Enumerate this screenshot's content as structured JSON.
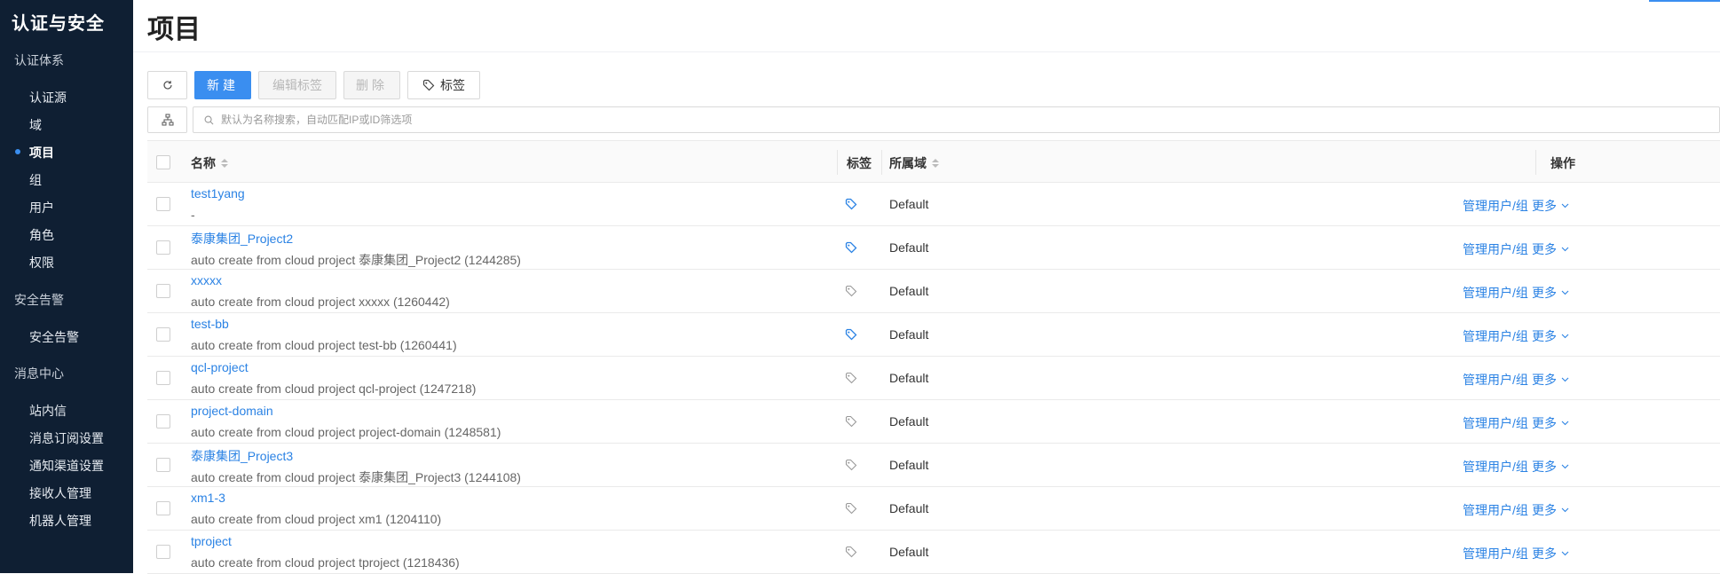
{
  "sidebar": {
    "app_title": "认证与安全",
    "groups": [
      {
        "label": "认证体系",
        "items": [
          "认证源",
          "域",
          "项目",
          "组",
          "用户",
          "角色",
          "权限"
        ]
      },
      {
        "label": "安全告警",
        "items": [
          "安全告警"
        ]
      },
      {
        "label": "消息中心",
        "items": [
          "站内信",
          "消息订阅设置",
          "通知渠道设置",
          "接收人管理",
          "机器人管理"
        ]
      }
    ],
    "active_item": "项目"
  },
  "page": {
    "title": "项目"
  },
  "toolbar": {
    "refresh_icon": "refresh-icon",
    "new_label": "新建",
    "edit_tags_label": "编辑标签",
    "delete_label": "删除",
    "tags_label": "标签",
    "tags_icon": "tag-icon"
  },
  "search": {
    "tree_icon": "hierarchy-icon",
    "search_icon": "search-icon",
    "placeholder": "默认为名称搜索，自动匹配IP或ID筛选项"
  },
  "table": {
    "columns": {
      "name": "名称",
      "tags": "标签",
      "domain": "所属域",
      "actions": "操作"
    },
    "action_manage": "管理用户/组",
    "action_more": "更多",
    "rows": [
      {
        "name": "test1yang",
        "desc": "-",
        "tagged": true,
        "domain": "Default"
      },
      {
        "name": "泰康集团_Project2",
        "desc": "auto create from cloud project 泰康集团_Project2 (1244285)",
        "tagged": true,
        "domain": "Default"
      },
      {
        "name": "xxxxx",
        "desc": "auto create from cloud project xxxxx (1260442)",
        "tagged": false,
        "domain": "Default"
      },
      {
        "name": "test-bb",
        "desc": "auto create from cloud project test-bb (1260441)",
        "tagged": true,
        "domain": "Default"
      },
      {
        "name": "qcl-project",
        "desc": "auto create from cloud project qcl-project (1247218)",
        "tagged": false,
        "domain": "Default"
      },
      {
        "name": "project-domain",
        "desc": "auto create from cloud project project-domain (1248581)",
        "tagged": false,
        "domain": "Default"
      },
      {
        "name": "泰康集团_Project3",
        "desc": "auto create from cloud project 泰康集团_Project3 (1244108)",
        "tagged": false,
        "domain": "Default"
      },
      {
        "name": "xm1-3",
        "desc": "auto create from cloud project xm1 (1204110)",
        "tagged": false,
        "domain": "Default"
      },
      {
        "name": "tproject",
        "desc": "auto create from cloud project tproject (1218436)",
        "tagged": false,
        "domain": "Default"
      }
    ]
  },
  "colors": {
    "sidebar_bg": "#0f1f33",
    "accent": "#3a8ef0",
    "link": "#2a82e4",
    "tag_active": "#2a82e4",
    "tag_inactive": "#999999"
  }
}
